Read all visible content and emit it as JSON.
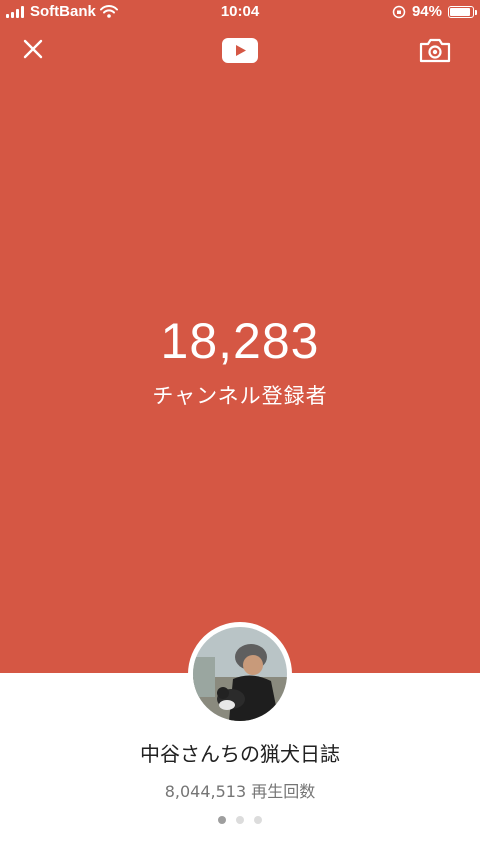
{
  "status_bar": {
    "carrier": "SoftBank",
    "time": "10:04",
    "battery_percent": "94%",
    "battery_level": 0.94
  },
  "header": {
    "close_icon": "close-icon",
    "logo_icon": "youtube-logo-icon",
    "camera_icon": "camera-icon"
  },
  "stats": {
    "subscriber_count": "18,283",
    "subscriber_label": "チャンネル登録者"
  },
  "channel": {
    "name": "中谷さんちの猟犬日誌",
    "views": "8,044,513 再生回数"
  },
  "pager": {
    "count": 3,
    "active_index": 0
  },
  "colors": {
    "hero_bg": "#D55744",
    "text_white": "#FFFFFF"
  }
}
